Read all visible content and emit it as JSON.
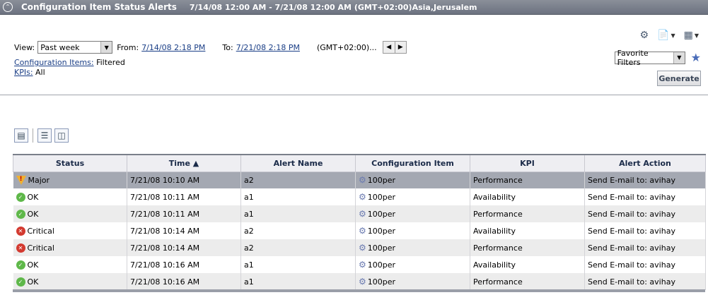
{
  "titlebar": {
    "title": "Configuration Item Status Alerts",
    "range": "7/14/08 12:00 AM - 7/21/08 12:00 AM (GMT+02:00)Asia,Jerusalem"
  },
  "filters": {
    "view_label": "View:",
    "view_value": "Past week",
    "from_label": "From:",
    "from_value": "7/14/08 2:18 PM",
    "to_label": "To:",
    "to_value": "7/21/08 2:18 PM",
    "timezone": "(GMT+02:00)...",
    "ci_label": "Configuration Items:",
    "ci_value": "Filtered",
    "kpi_label": "KPIs:",
    "kpi_value": "All",
    "favorite_filters": "Favorite Filters",
    "generate": "Generate"
  },
  "table": {
    "headers": [
      "Status",
      "Time ▲",
      "Alert Name",
      "Configuration Item",
      "KPI",
      "Alert Action"
    ],
    "rows": [
      {
        "status": "Major",
        "time": "7/21/08 10:10 AM",
        "alert": "a2",
        "ci": "100per",
        "kpi": "Performance",
        "action": "Send E-mail to: avihay"
      },
      {
        "status": "OK",
        "time": "7/21/08 10:11 AM",
        "alert": "a1",
        "ci": "100per",
        "kpi": "Availability",
        "action": "Send E-mail to: avihay"
      },
      {
        "status": "OK",
        "time": "7/21/08 10:11 AM",
        "alert": "a1",
        "ci": "100per",
        "kpi": "Performance",
        "action": "Send E-mail to: avihay"
      },
      {
        "status": "Critical",
        "time": "7/21/08 10:14 AM",
        "alert": "a2",
        "ci": "100per",
        "kpi": "Availability",
        "action": "Send E-mail to: avihay"
      },
      {
        "status": "Critical",
        "time": "7/21/08 10:14 AM",
        "alert": "a2",
        "ci": "100per",
        "kpi": "Performance",
        "action": "Send E-mail to: avihay"
      },
      {
        "status": "OK",
        "time": "7/21/08 10:16 AM",
        "alert": "a1",
        "ci": "100per",
        "kpi": "Availability",
        "action": "Send E-mail to: avihay"
      },
      {
        "status": "OK",
        "time": "7/21/08 10:16 AM",
        "alert": "a1",
        "ci": "100per",
        "kpi": "Performance",
        "action": "Send E-mail to: avihay"
      }
    ]
  },
  "colors": {
    "ok": "#5fb84a",
    "critical": "#d33a30",
    "major": "#f0b030",
    "selected_row": "#a4a8b2"
  }
}
